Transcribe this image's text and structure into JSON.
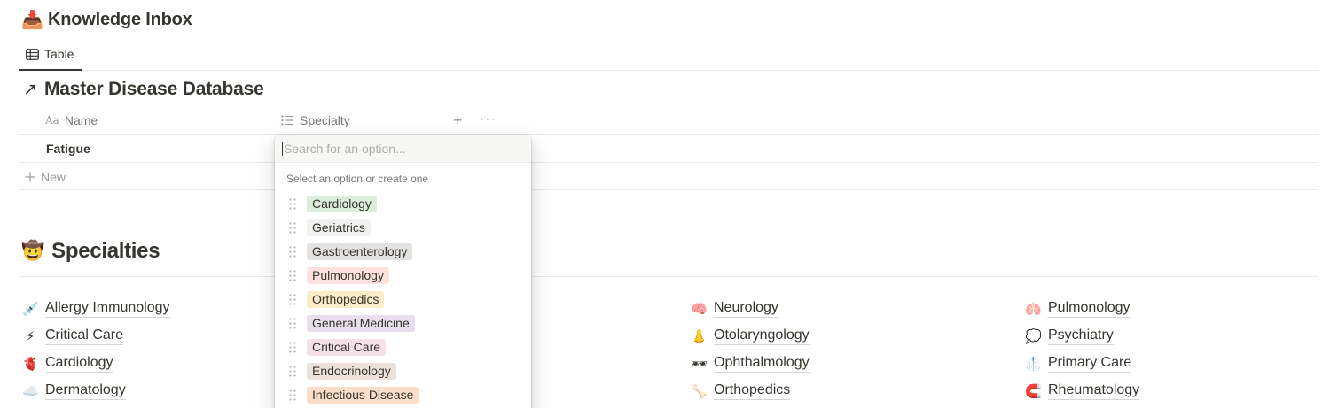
{
  "page": {
    "icon": "inbox-tray-icon",
    "emoji": "📥",
    "title": "Knowledge Inbox"
  },
  "view": {
    "tab_label": "Table",
    "tab_icon": "table-icon"
  },
  "database": {
    "arrow": "↗",
    "title": "Master Disease Database",
    "columns": [
      {
        "label": "Name",
        "icon": "Aa"
      },
      {
        "label": "Specialty",
        "icon": "list-icon"
      }
    ],
    "add_column": "+",
    "more": "···",
    "rows": [
      {
        "name": "Fatigue"
      }
    ],
    "new_label": "New"
  },
  "dropdown": {
    "search_placeholder": "Search for an option...",
    "hint": "Select an option or create one",
    "options": [
      {
        "label": "Cardiology",
        "color": "#dbeddb"
      },
      {
        "label": "Geriatrics",
        "color": "#f1f1ef"
      },
      {
        "label": "Gastroenterology",
        "color": "#e3e2e0"
      },
      {
        "label": "Pulmonology",
        "color": "#ffe2dd"
      },
      {
        "label": "Orthopedics",
        "color": "#fdecc8"
      },
      {
        "label": "General Medicine",
        "color": "#e8deee"
      },
      {
        "label": "Critical Care",
        "color": "#f5e0e9"
      },
      {
        "label": "Endocrinology",
        "color": "#eee0da"
      },
      {
        "label": "Infectious Disease",
        "color": "#fadec9"
      }
    ]
  },
  "specialties": {
    "emoji": "🤠",
    "title": "Specialties",
    "columns": [
      [
        {
          "emoji": "💉",
          "label": "Allergy Immunology"
        },
        {
          "emoji": "⚡",
          "label": "Critical Care"
        },
        {
          "emoji": "🫀",
          "label": "Cardiology"
        },
        {
          "emoji": "☁️",
          "label": "Dermatology"
        }
      ],
      [
        {
          "emoji": "🧠",
          "label": "Neurology"
        },
        {
          "emoji": "👃",
          "label": "Otolaryngology"
        },
        {
          "emoji": "🕶",
          "label": "Ophthalmology"
        },
        {
          "emoji": "🦴",
          "label": "Orthopedics"
        }
      ],
      [
        {
          "emoji": "🫁",
          "label": "Pulmonology"
        },
        {
          "emoji": "💭",
          "label": "Psychiatry"
        },
        {
          "emoji": "🥼",
          "label": "Primary Care"
        },
        {
          "emoji": "🧲",
          "label": "Rheumatology"
        }
      ]
    ]
  }
}
